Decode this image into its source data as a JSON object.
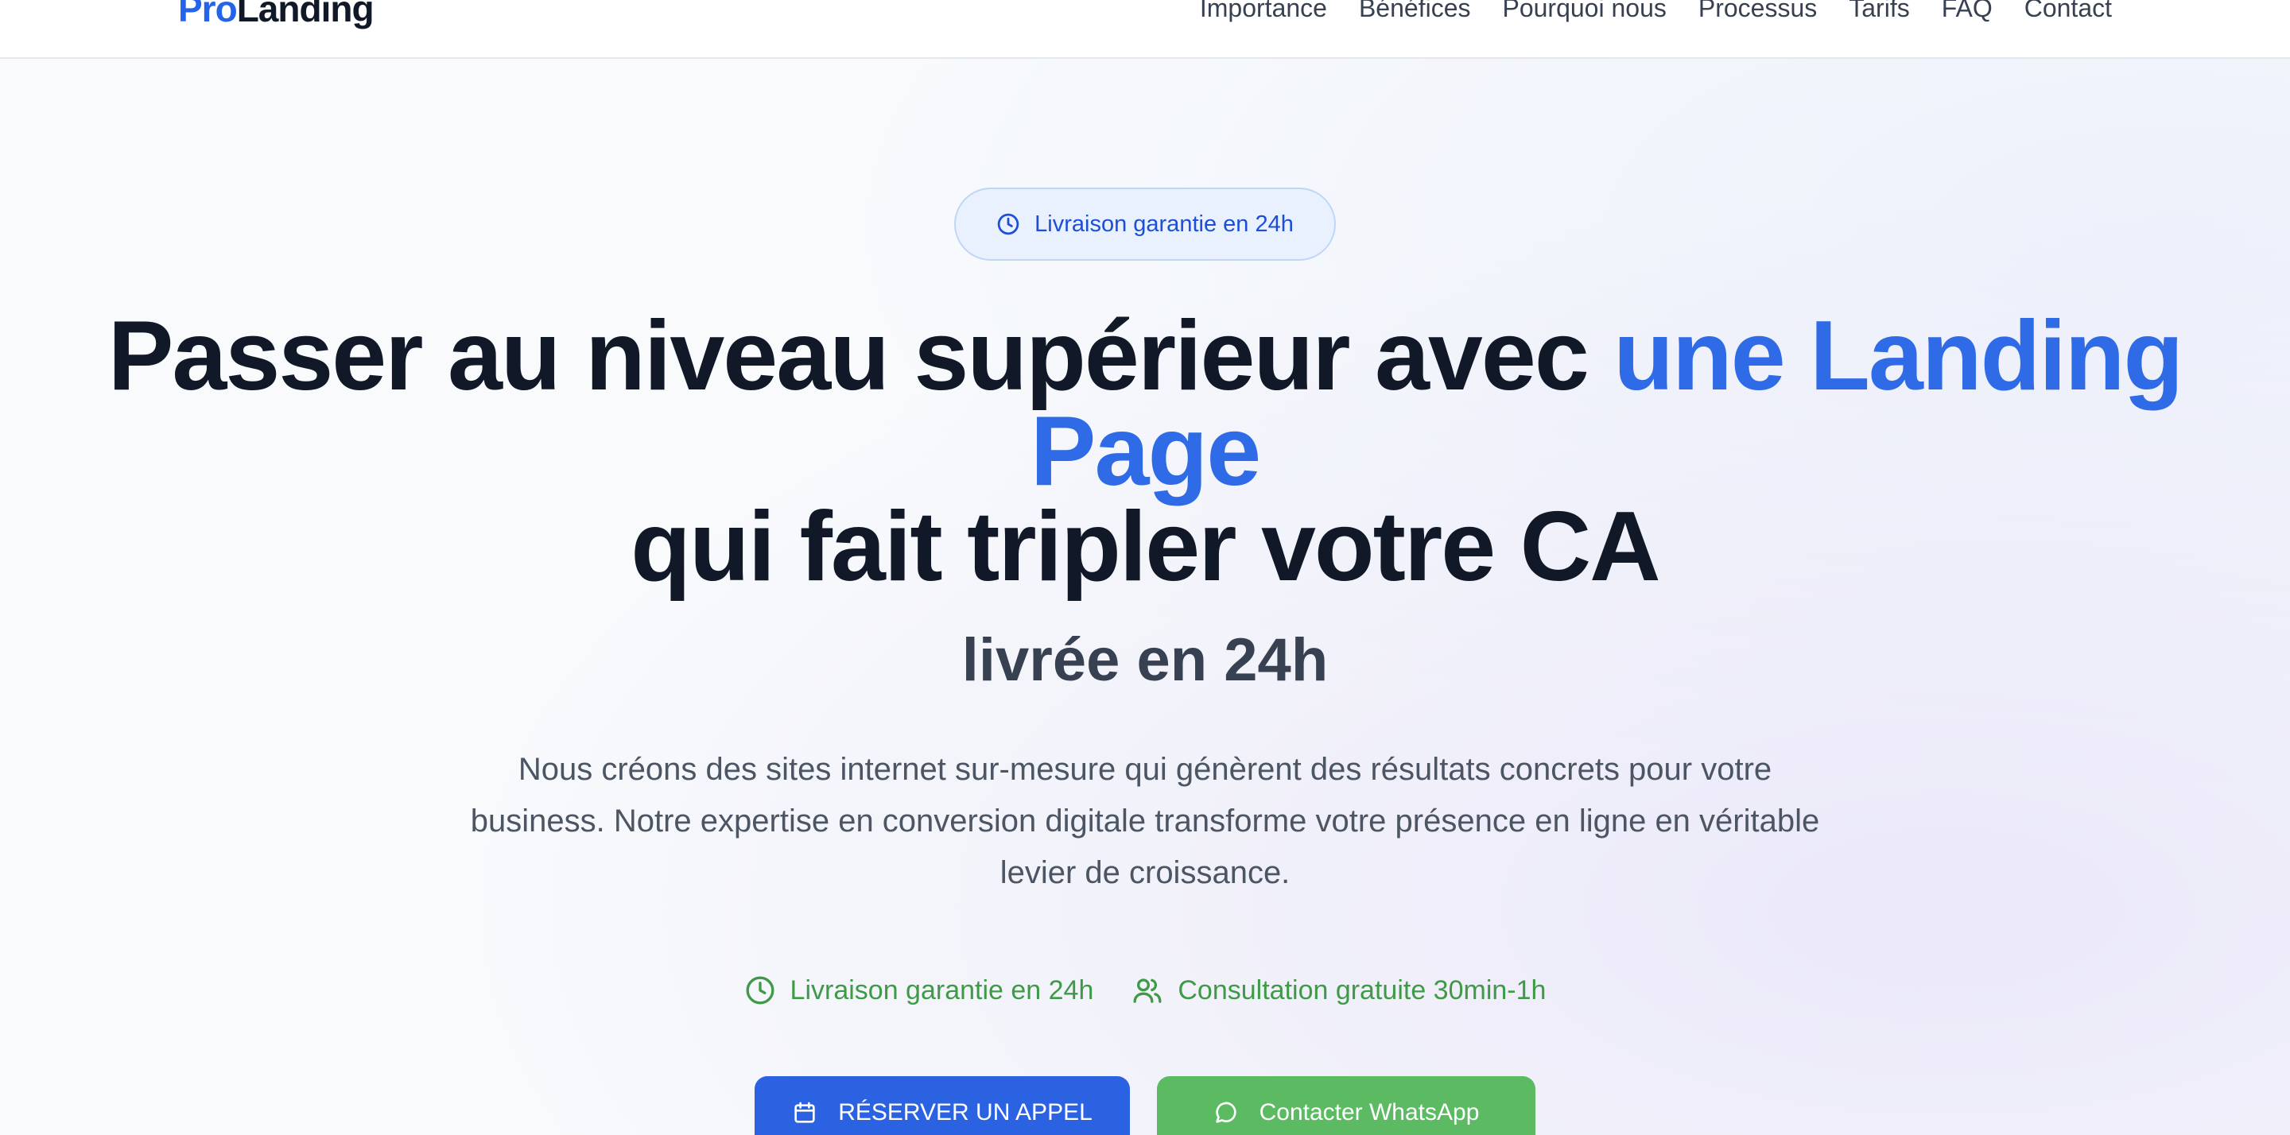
{
  "header": {
    "logo_pro": "Pro",
    "logo_landing": "Landing",
    "nav": [
      "Importance",
      "Bénéfices",
      "Pourquoi nous",
      "Processus",
      "Tarifs",
      "FAQ",
      "Contact"
    ]
  },
  "hero": {
    "badge": "Livraison garantie en 24h",
    "headline_part1": "Passer au niveau supérieur avec ",
    "headline_accent": "une Landing Page",
    "headline_part2": "qui fait tripler votre CA",
    "subheadline": "livrée en 24h",
    "description": "Nous créons des sites internet sur-mesure qui génèrent des résultats concrets pour votre business. Notre expertise en conversion digitale transforme votre présence en ligne en véritable levier de croissance.",
    "features": [
      {
        "icon": "clock-icon",
        "label": "Livraison garantie en 24h"
      },
      {
        "icon": "users-icon",
        "label": "Consultation gratuite 30min-1h"
      }
    ],
    "cta_primary": "RÉSERVER UN APPEL",
    "cta_whatsapp": "Contacter WhatsApp"
  },
  "colors": {
    "brand": "#2563eb",
    "accent_text": "#2f6be6",
    "success": "#3f9a47",
    "whatsapp": "#5cba63"
  }
}
